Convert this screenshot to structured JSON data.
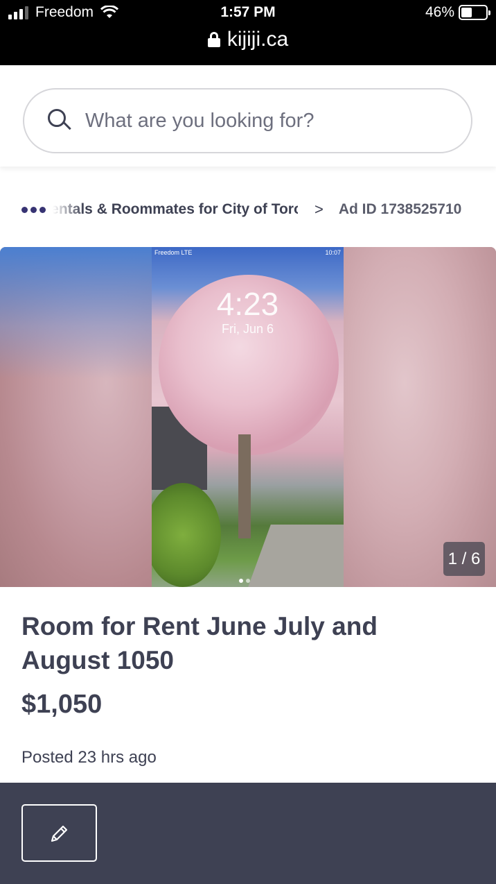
{
  "status_bar": {
    "carrier": "Freedom",
    "time": "1:57 PM",
    "battery": "46%",
    "battery_level": 0.46
  },
  "browser": {
    "url": "kijiji.ca"
  },
  "search": {
    "placeholder": "What are you looking for?"
  },
  "breadcrumb": {
    "category": "Rentals & Roommates for City of Toronto",
    "separator": ">",
    "ad_id": "Ad ID 1738525710"
  },
  "gallery": {
    "counter": "1 / 6",
    "photo_status_carrier": "Freedom  LTE",
    "photo_status_battery": "10:07",
    "photo_lock_time": "4:23",
    "photo_lock_date": "Fri, Jun 6"
  },
  "listing": {
    "title": "Room for Rent June July and August 1050",
    "price": "$1,050",
    "posted": "Posted 23 hrs ago"
  },
  "icons": {
    "search": "search-icon",
    "lock": "lock-icon",
    "edit": "pencil-icon",
    "more": "ellipsis-icon"
  }
}
